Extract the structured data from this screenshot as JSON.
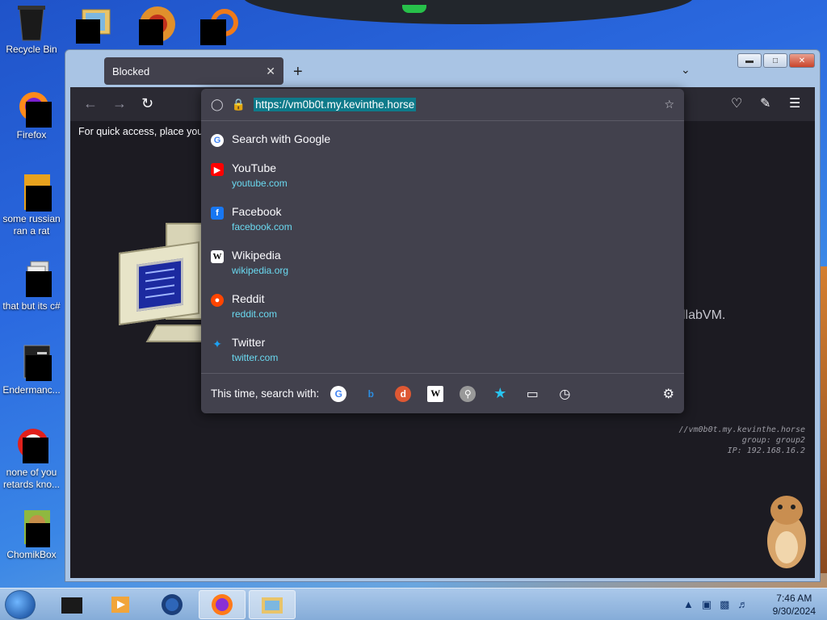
{
  "desktop": {
    "icons": [
      {
        "label": "Recycle Bin"
      },
      {
        "label": "Firefox"
      },
      {
        "label": "some russian ran a rat"
      },
      {
        "label": "that but its c#"
      },
      {
        "label": "Endermanc..."
      },
      {
        "label": "none of you retards kno..."
      },
      {
        "label": "ChomikBox"
      }
    ]
  },
  "browser": {
    "tab": {
      "title": "Blocked"
    },
    "toolbar": {
      "bookmarks_hint": "For quick access, place your b"
    },
    "urlbar": {
      "url": "https://vm0b0t.my.kevinthe.horse"
    },
    "page": {
      "right_text": "llabVM.",
      "info_lines": [
        "//vm0b0t.my.kevinthe.horse",
        "group: group2",
        "IP: 192.168.16.2"
      ]
    },
    "dropdown": {
      "search_label": "Search with Google",
      "results": [
        {
          "title": "YouTube",
          "url": "youtube.com",
          "icon": "youtube-icon",
          "color": "#ff0000"
        },
        {
          "title": "Facebook",
          "url": "facebook.com",
          "icon": "facebook-icon",
          "color": "#1877f2"
        },
        {
          "title": "Wikipedia",
          "url": "wikipedia.org",
          "icon": "wikipedia-icon",
          "color": "#ffffff"
        },
        {
          "title": "Reddit",
          "url": "reddit.com",
          "icon": "reddit-icon",
          "color": "#ff4500"
        },
        {
          "title": "Twitter",
          "url": "twitter.com",
          "icon": "twitter-icon",
          "color": "#1da1f2"
        }
      ],
      "oneoff_label": "This time, search with:"
    }
  },
  "taskbar": {
    "time": "7:46 AM",
    "date": "9/30/2024"
  },
  "colors": {
    "url_highlight": "#0e7a8a",
    "result_url": "#6ad9f0",
    "panel_bg": "#42414d"
  }
}
